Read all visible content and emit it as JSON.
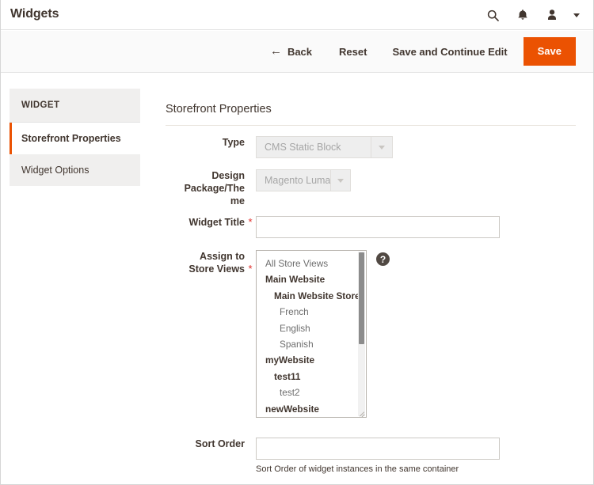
{
  "header": {
    "title": "Widgets",
    "icons": [
      {
        "name": "search-icon",
        "label": "Search"
      },
      {
        "name": "notifications-icon",
        "label": "Notifications"
      },
      {
        "name": "user-icon",
        "label": "Account"
      },
      {
        "name": "chevron-down-icon",
        "label": "More"
      }
    ]
  },
  "toolbar": {
    "back_label": "Back",
    "back_arrow": "←",
    "reset_label": "Reset",
    "save_continue_label": "Save and Continue Edit",
    "save_label": "Save",
    "primary_color": "#eb5202"
  },
  "sidebar": {
    "heading": "WIDGET",
    "items": [
      {
        "label": "Storefront Properties",
        "active": true
      },
      {
        "label": "Widget Options",
        "active": false
      }
    ],
    "active_accent_color": "#eb5202"
  },
  "main": {
    "section_title": "Storefront Properties",
    "required_marker": "*",
    "required_color": "#e02b27",
    "fields": {
      "type": {
        "label": "Type",
        "value": "CMS Static Block",
        "disabled": true,
        "required": false
      },
      "design_theme": {
        "label": "Design Package/The me",
        "label_line1": "Design",
        "label_line2": "Package/The",
        "label_line3": "me",
        "value": "Magento Luma",
        "disabled": true,
        "required": false
      },
      "widget_title": {
        "label": "Widget Title",
        "value": "",
        "placeholder": "",
        "required": true
      },
      "store_views": {
        "label": "Assign to Store Views",
        "label_line1": "Assign to",
        "label_line2": "Store Views",
        "required": true,
        "help_icon": "?",
        "help_icon_name": "help-tooltip-icon",
        "scroll_thumb_percent": 55,
        "options": [
          {
            "label": "All Store Views",
            "level": "all"
          },
          {
            "label": "Main Website",
            "level": "website"
          },
          {
            "label": "Main Website Store",
            "level": "group"
          },
          {
            "label": "French",
            "level": "view"
          },
          {
            "label": "English",
            "level": "view"
          },
          {
            "label": "Spanish",
            "level": "view"
          },
          {
            "label": "myWebsite",
            "level": "website"
          },
          {
            "label": "test11",
            "level": "group"
          },
          {
            "label": "test2",
            "level": "view"
          },
          {
            "label": "newWebsite",
            "level": "website"
          }
        ]
      },
      "sort_order": {
        "label": "Sort Order",
        "value": "",
        "placeholder": "",
        "required": false,
        "hint": "Sort Order of widget instances in the same container"
      }
    }
  }
}
